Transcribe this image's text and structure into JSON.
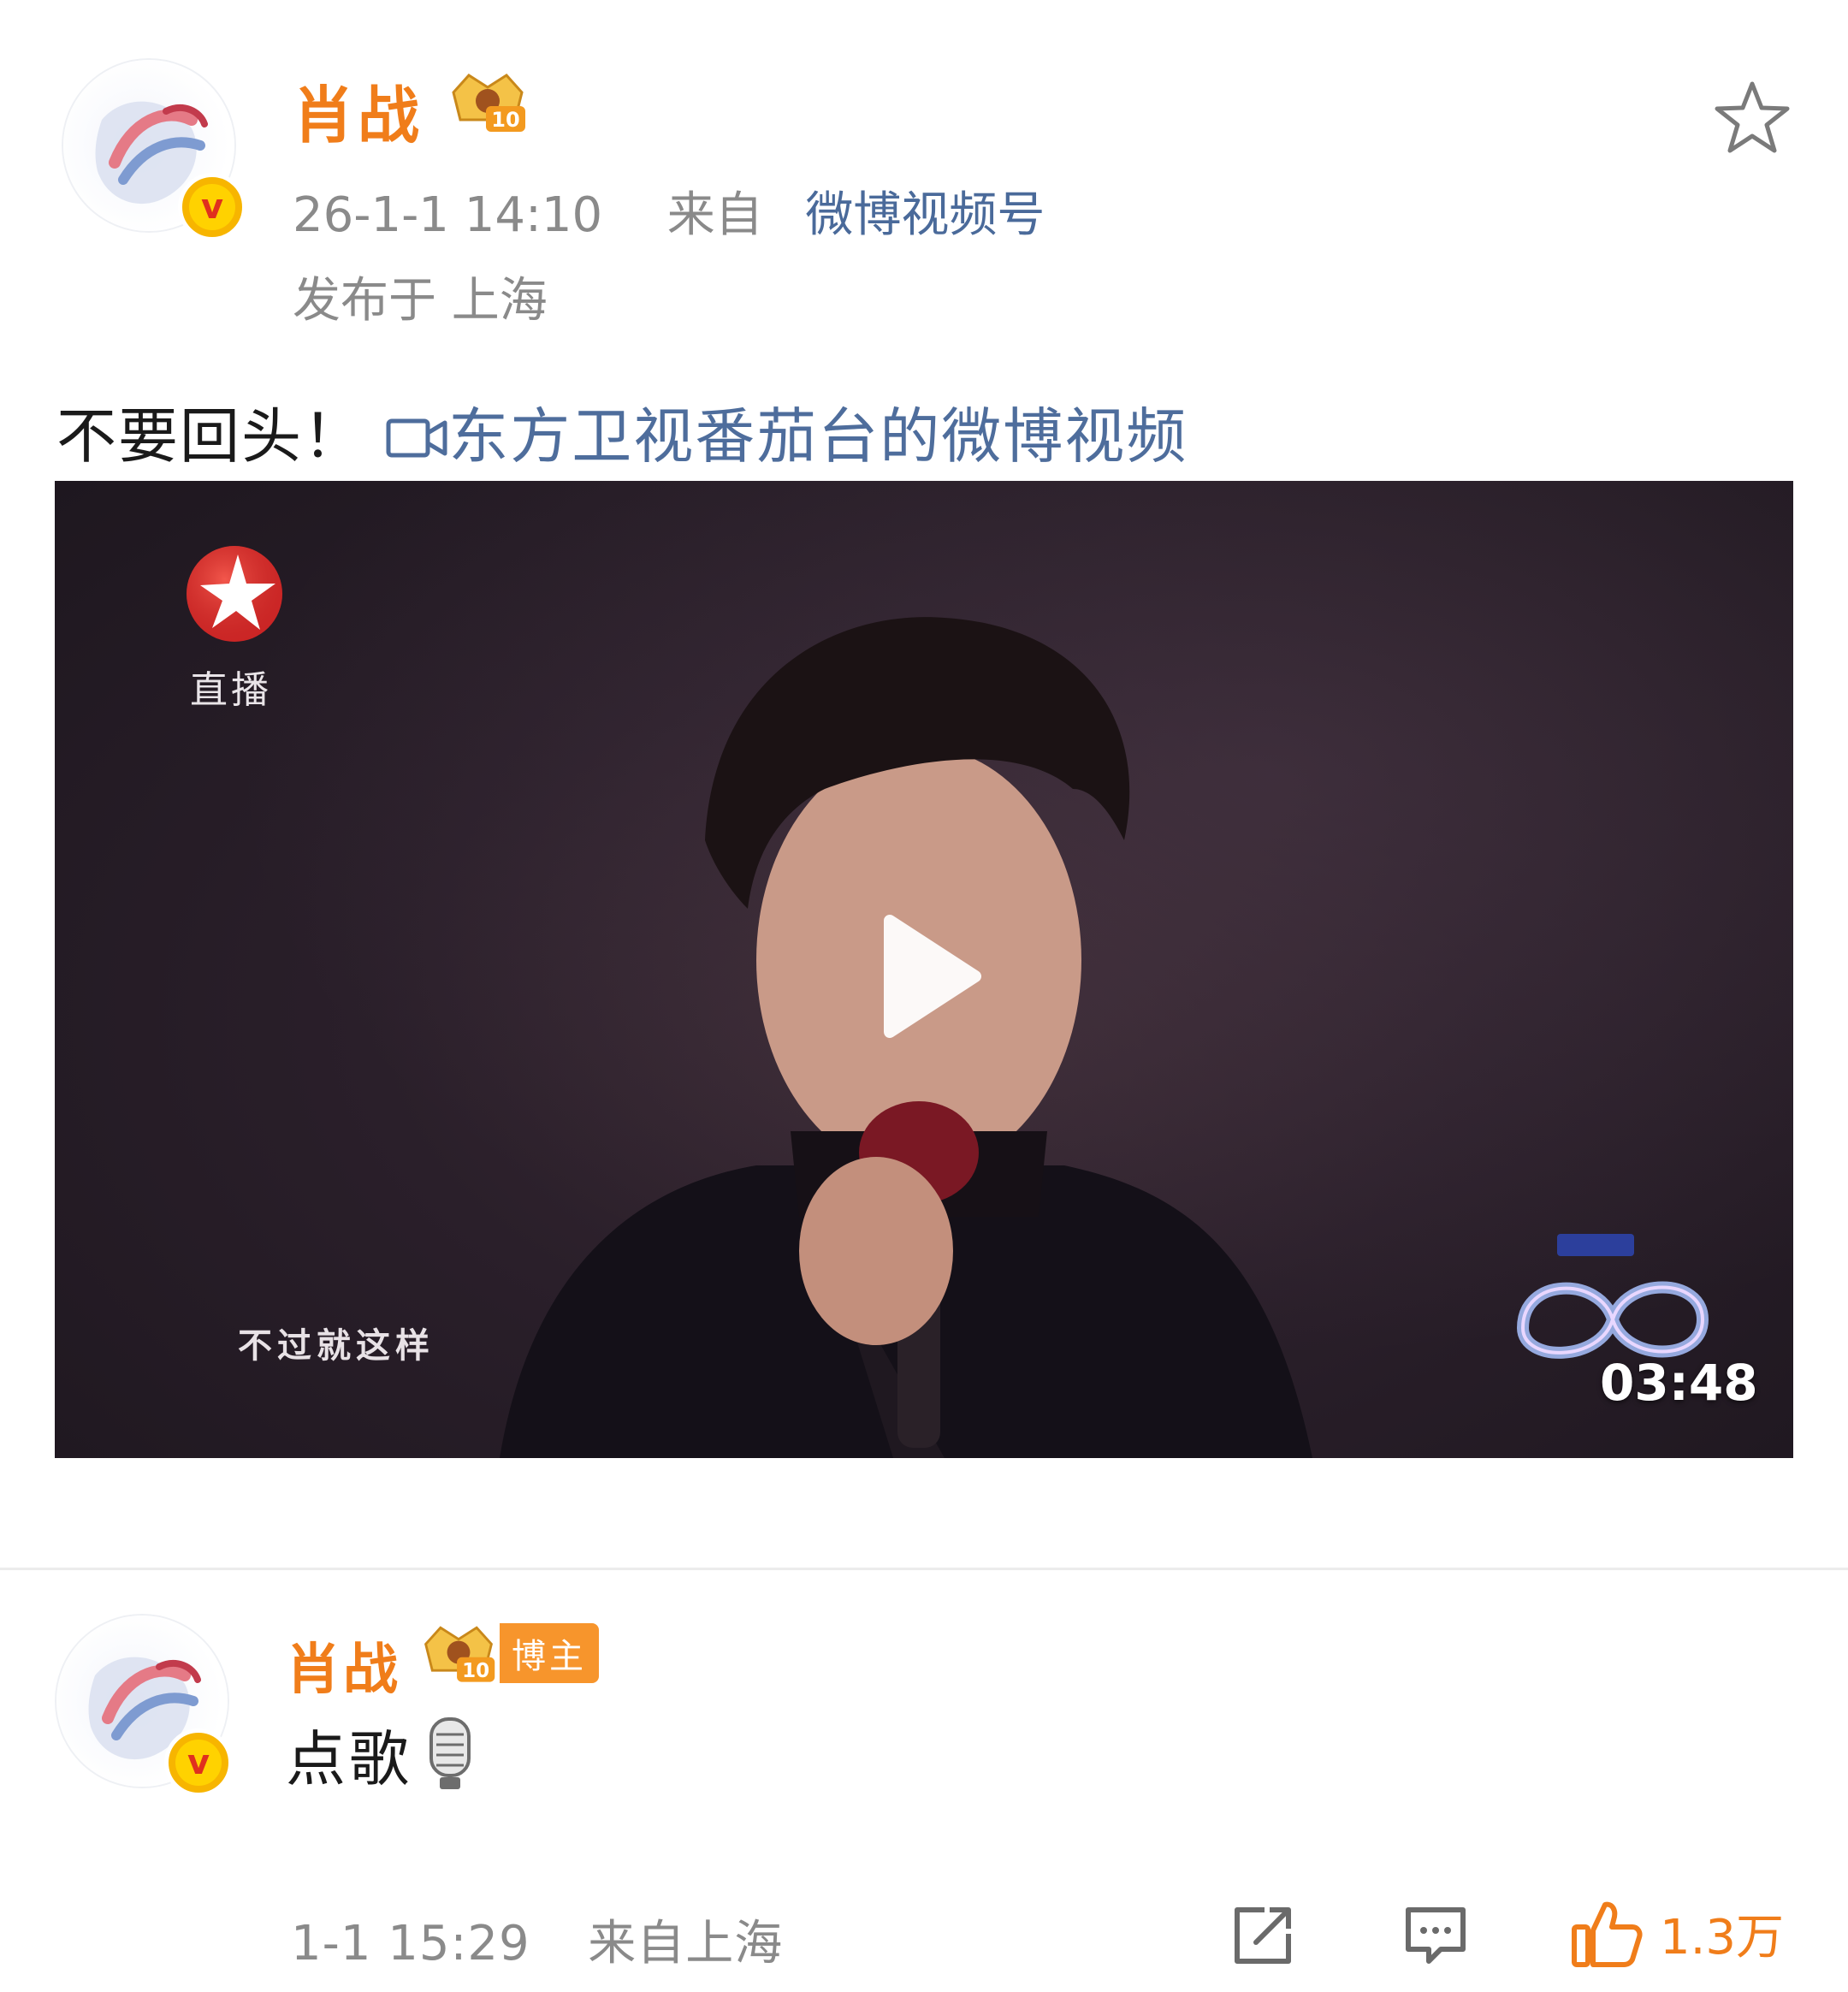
{
  "post": {
    "author": "肖战",
    "time": "26-1-1 14:10",
    "source_prefix": "来自",
    "source": "微博视频号",
    "location": "发布于 上海",
    "text": "不要回头！",
    "video_link": "东方卫视番茄台的微博视频",
    "badge_level": "10"
  },
  "video": {
    "channel_label": "直播",
    "subtitle": "不过就这样",
    "duration": "03:48"
  },
  "comment": {
    "author": "肖战",
    "badge_level": "10",
    "author_tag": "博主",
    "text": "点歌",
    "time": "1-1 15:29",
    "source": "来自上海",
    "like_count": "1.3万"
  },
  "colors": {
    "accent": "#f07d1a",
    "link": "#4e6d9c",
    "meta": "#8a8a8a"
  },
  "icons": [
    "star-icon",
    "video-camera-icon",
    "play-icon",
    "microphone-icon",
    "share-icon",
    "comment-icon",
    "like-icon",
    "verified-icon",
    "crown-badge-icon"
  ]
}
